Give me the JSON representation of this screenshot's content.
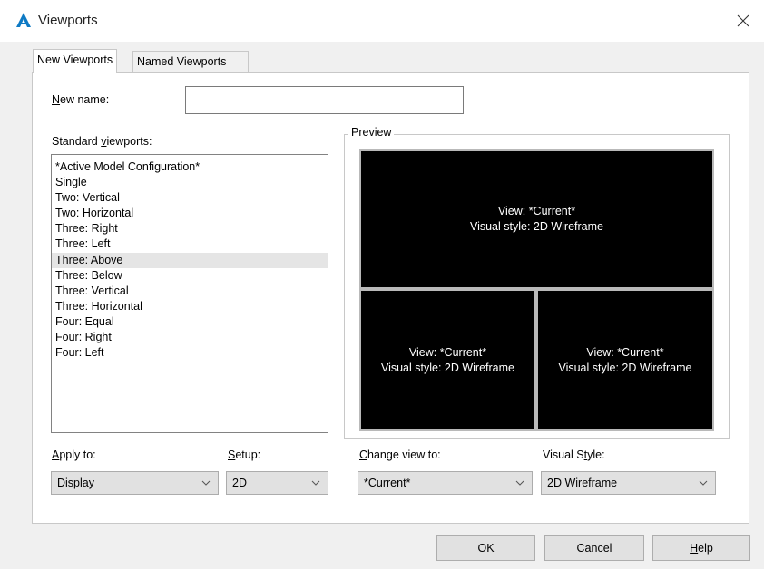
{
  "window": {
    "title": "Viewports"
  },
  "tabs": [
    {
      "label": "New Viewports"
    },
    {
      "label": "Named Viewports"
    }
  ],
  "new_name": {
    "label_underline": "N",
    "label_rest": "ew name:",
    "value": ""
  },
  "standard_viewports": {
    "label_pre": "Standard ",
    "label_underline": "v",
    "label_post": "iewports:",
    "items": [
      "*Active Model Configuration*",
      "Single",
      "Two:  Vertical",
      "Two:  Horizontal",
      "Three: Right",
      "Three: Left",
      "Three: Above",
      "Three: Below",
      "Three: Vertical",
      "Three: Horizontal",
      "Four:  Equal",
      "Four:  Right",
      "Four:  Left"
    ],
    "selected": "Three: Above"
  },
  "preview": {
    "label": "Preview",
    "viewports": [
      {
        "view": "View: *Current*",
        "style": "Visual style: 2D Wireframe"
      },
      {
        "view": "View: *Current*",
        "style": "Visual style: 2D Wireframe"
      },
      {
        "view": "View: *Current*",
        "style": "Visual style: 2D Wireframe"
      }
    ]
  },
  "apply_to": {
    "label_underline": "A",
    "label_rest": "pply to:",
    "value": "Display"
  },
  "setup": {
    "label_underline": "S",
    "label_rest": "etup:",
    "value": "2D"
  },
  "change_view_to": {
    "label_underline": "C",
    "label_rest": "hange view to:",
    "value": "*Current*"
  },
  "visual_style": {
    "label_pre": "Visual S",
    "label_underline": "t",
    "label_post": "yle:",
    "value": "2D Wireframe"
  },
  "buttons": {
    "ok": "OK",
    "cancel": "Cancel",
    "help_underline": "H",
    "help_rest": "elp"
  },
  "colors": {
    "accent": "#0e7ac4",
    "viewport_bg": "#000000",
    "selection": "#e5e5e5"
  },
  "icons": {
    "app": "autocad-a-icon",
    "close": "close-icon",
    "dropdown": "chevron-down-icon"
  }
}
